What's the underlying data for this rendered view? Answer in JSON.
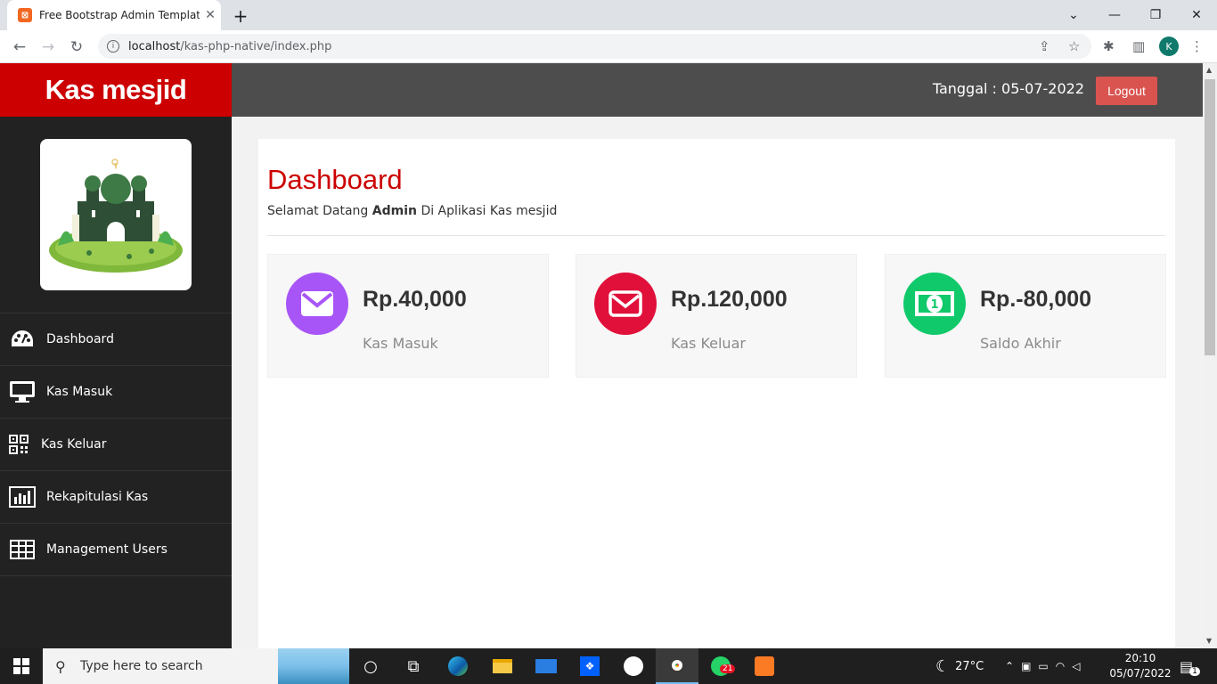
{
  "browser": {
    "tab_title": "Free Bootstrap Admin Template :",
    "url_host": "localhost",
    "url_path": "/kas-php-native/index.php",
    "profile_initial": "K"
  },
  "app": {
    "brand": "Kas mesjid",
    "date_label": "Tanggal : 05-07-2022",
    "logout_label": "Logout"
  },
  "sidebar": {
    "items": [
      {
        "label": "Dashboard",
        "icon": "dashboard-icon"
      },
      {
        "label": "Kas Masuk",
        "icon": "desktop-icon"
      },
      {
        "label": "Kas Keluar",
        "icon": "qrcode-icon"
      },
      {
        "label": "Rekapitulasi Kas",
        "icon": "bar-chart-icon"
      },
      {
        "label": "Management Users",
        "icon": "table-icon"
      }
    ]
  },
  "dashboard": {
    "title": "Dashboard",
    "welcome_prefix": "Selamat Datang",
    "welcome_user": "Admin",
    "welcome_suffix": "Di Aplikasi Kas mesjid",
    "cards": [
      {
        "amount": "Rp.40,000",
        "label": "Kas Masuk",
        "color": "#a855f7",
        "icon": "envelope-icon"
      },
      {
        "amount": "Rp.120,000",
        "label": "Kas Keluar",
        "color": "#e0103a",
        "icon": "envelope-icon"
      },
      {
        "amount": "Rp.-80,000",
        "label": "Saldo Akhir",
        "color": "#10c96a",
        "icon": "money-icon"
      }
    ]
  },
  "taskbar": {
    "search_placeholder": "Type here to search",
    "weather": "27°C",
    "time": "20:10",
    "date": "05/07/2022",
    "whatsapp_badge": "21",
    "notification_count": "1"
  }
}
